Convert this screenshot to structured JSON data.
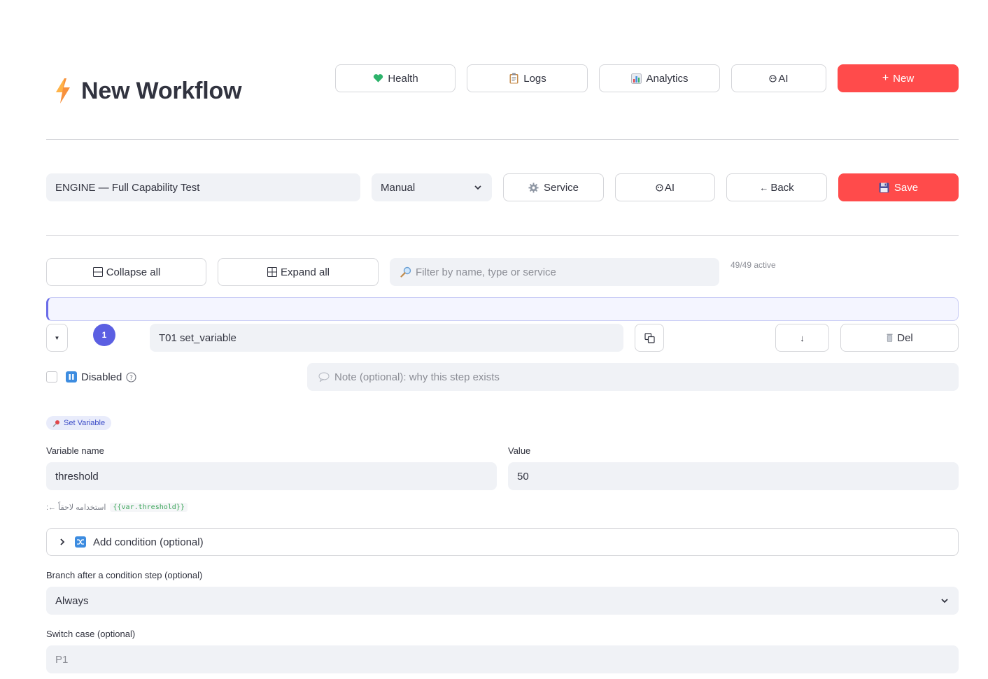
{
  "header": {
    "title": "New Workflow",
    "logo_icon": "lightning-icon",
    "buttons": [
      {
        "label": "Health",
        "icon": "green-heart-icon"
      },
      {
        "label": "Logs",
        "icon": "clipboard-icon"
      },
      {
        "label": "Analytics",
        "icon": "bar-chart-icon"
      },
      {
        "label": "AI",
        "icon": "ai-icon"
      },
      {
        "label": "New",
        "icon": "plus-icon"
      }
    ]
  },
  "toolbar": {
    "workflow_name": "ENGINE — Full Capability Test",
    "trigger_select": "Manual",
    "service_label": "Service",
    "ai_label": "AI",
    "back_label": "Back",
    "save_label": "Save"
  },
  "steps_controls": {
    "collapse_label": "Collapse all",
    "expand_label": "Expand all",
    "filter_placeholder": "Filter by name, type or service",
    "active_count": "49/49 active"
  },
  "step": {
    "number": "1",
    "name": "T01 set_variable",
    "del_label": "Del",
    "disabled_label": "Disabled",
    "note_placeholder": "Note (optional): why this step exists",
    "type_tag": "Set Variable",
    "variable_name_label": "Variable name",
    "variable_name_value": "threshold",
    "value_label": "Value",
    "value_value": "50",
    "usage_hint": "استخدامه لاحقاً ←:",
    "usage_code": "{{var.threshold}}",
    "condition_label": "Add condition (optional)",
    "branch_label": "Branch after a condition step (optional)",
    "branch_value": "Always",
    "switch_label": "Switch case (optional)",
    "switch_placeholder": "P1"
  },
  "colors": {
    "primary": "#ff4b4b",
    "accent": "#5b5fe2",
    "field_bg": "#f0f2f6"
  }
}
